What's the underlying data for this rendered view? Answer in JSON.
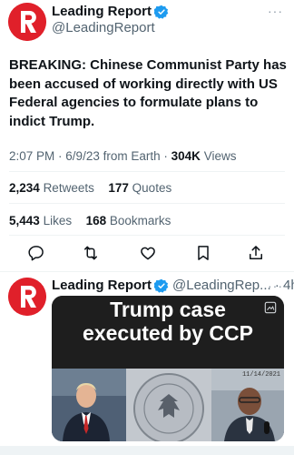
{
  "main_tweet": {
    "display_name": "Leading Report",
    "handle": "@LeadingReport",
    "more_icon": "ellipsis-icon",
    "text": "BREAKING: Chinese Communist Party has been accused of working directly with US Federal agencies to formulate plans to indict Trump.",
    "time": "2:07 PM",
    "date": "6/9/23",
    "source": "from Earth",
    "views_count": "304K",
    "views_label": "Views",
    "retweets_count": "2,234",
    "retweets_label": "Retweets",
    "quotes_count": "177",
    "quotes_label": "Quotes",
    "likes_count": "5,443",
    "likes_label": "Likes",
    "bookmarks_count": "168",
    "bookmarks_label": "Bookmarks"
  },
  "reply_tweet": {
    "display_name": "Leading Report",
    "handle": "@LeadingRep...",
    "age": "4h",
    "media_caption_line1": "Trump case",
    "media_caption_line2": "executed by CCP",
    "media_date": "11/14/2021"
  },
  "colors": {
    "brand_red": "#e0202a",
    "verified_blue": "#1d9bf0",
    "muted": "#536471",
    "text": "#0f1419"
  }
}
